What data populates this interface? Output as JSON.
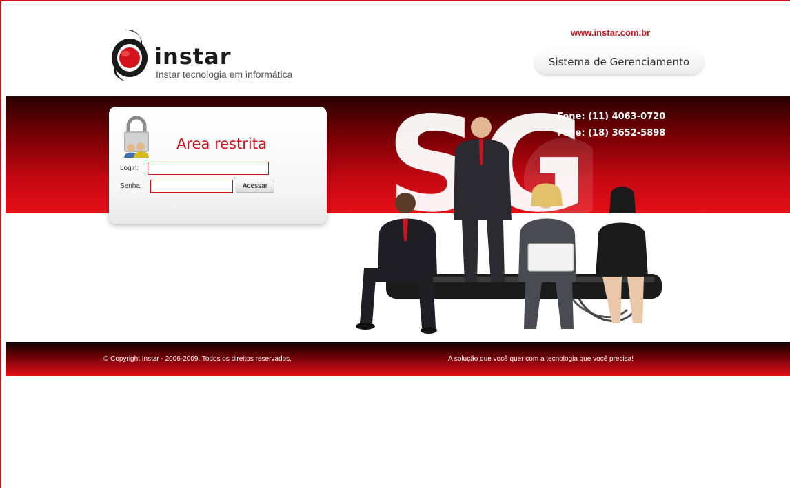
{
  "header": {
    "logo_word": "instar",
    "logo_tagline": "Instar tecnologia em informática",
    "site_url": "www.instar.com.br",
    "system_label": "Sistema de Gerenciamento"
  },
  "login": {
    "title": "Area restrita",
    "login_label": "Login:",
    "login_value": "",
    "senha_label": "Senha:",
    "senha_value": "",
    "submit_label": "Acessar"
  },
  "contact": {
    "phone_1": "Fone: (11) 4063-0720",
    "phone_2": "Fone: (18) 3652-5898"
  },
  "banner": {
    "letters": "SG"
  },
  "footer": {
    "copyright": "© Copyright Instar - 2006-2009. Todos os direitos reservados.",
    "slogan": "A solução que você quer com a tecnologia que você precisa!"
  },
  "colors": {
    "brand_red": "#c8141e",
    "band_dark": "#2a0000",
    "band_light": "#e50f18"
  },
  "icons": [
    "instar-logo-icon",
    "padlock-users-icon"
  ]
}
